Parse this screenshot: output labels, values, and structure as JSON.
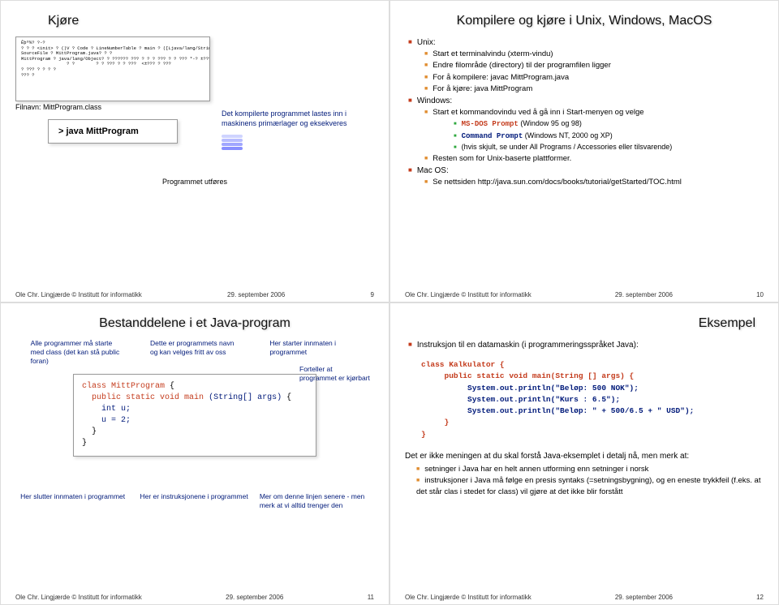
{
  "footer": {
    "author": "Ole Chr. Lingjærde © Institutt for informatikk",
    "date": "29. september 2006"
  },
  "slide9": {
    "num": "9",
    "title": "Kjøre",
    "bytecode": "Êþº¾? ?-?\n? ? ? <init> ? ()V ? Code ? LineNumberTable ? main ? ([Ljava/lang/String;)V ?\nSourceFile ? MittProgram.java? ? ?\nMittProgram ? java/lang/Object? ? ?????? ??? ? ? ? ??? ? ? ??? *-? ±??? ? ??? ? ??? ?\n                 ? ?        ? ? ??? ? ? ???  <±??? ? ???\n? ??? ? ? ? ?\n??? ?",
    "filnavn": "Filnavn: MittProgram.class",
    "prompt": "> java MittProgram",
    "annot1": "Det kompilerte programmet lastes inn i maskinens primærlager og eksekveres",
    "annot2": "Programmet utføres"
  },
  "slide10": {
    "num": "10",
    "title": "Kompilere og kjøre i Unix, Windows, MacOS",
    "unix_h": "Unix:",
    "unix1": "Start et terminalvindu (xterm-vindu)",
    "unix2": "Endre filområde (directory) til der programfilen ligger",
    "unix3": "For å kompilere: javac MittProgram.java",
    "unix4": "For å kjøre: java MittProgram",
    "win_h": "Windows:",
    "win1": "Start et kommandovindu ved å gå inn i Start-menyen og velge",
    "win1a": "MS-DOS Prompt",
    "win1a_sfx": " (Window 95 og 98)",
    "win1b": "Command Prompt",
    "win1b_sfx": " (Windows NT, 2000 og XP)",
    "win1c": "(hvis skjult, se under All Programs / Accessories eller tilsvarende)",
    "win2": "Resten som for Unix-baserte plattformer.",
    "mac_h": "Mac OS:",
    "mac1": "Se nettsiden http://java.sun.com/docs/books/tutorial/getStarted/TOC.html"
  },
  "slide11": {
    "num": "11",
    "title": "Bestanddelene i et Java-program",
    "a1": "Alle programmer må starte med class (det kan stå public foran)",
    "a2": "Dette er programmets navn og kan velges fritt av oss",
    "a3": "Her starter innmaten i programmet",
    "a4": "Forteller at programmet er kjørbart",
    "a5": "Her slutter innmaten i programmet",
    "a6": "Her er instruksjonene i programmet",
    "a7": "Mer om denne linjen senere - men merk at vi alltid trenger den",
    "code": "class MittProgram {\n  public static void main (String[] args) {\n    int u;\n    u = 2;\n  }\n}"
  },
  "slide12": {
    "num": "12",
    "title": "Eksempel",
    "intro": "Instruksjon til en datamaskin (i programmeringsspråket Java):",
    "code_l1": "class Kalkulator {",
    "code_l2": "     public static void main(String [] args) {",
    "code_l3": "          System.out.println(\"Beløp: 500 NOK\");",
    "code_l4": "          System.out.println(\"Kurs : 6.5\");",
    "code_l5": "          System.out.println(\"Beløp: \" + 500/6.5 + \" USD\");",
    "code_l6": "     }",
    "code_l7": "}",
    "note_intro": "Det er ikke meningen at du skal forstå Java-eksemplet i detalj nå, men merk at:",
    "note1": "setninger i Java har en helt annen utforming enn setninger i norsk",
    "note2": "instruksjoner i Java må følge en presis syntaks (=setningsbygning), og en eneste trykkfeil (f.eks. at det står clas i stedet for class) vil gjøre at det ikke blir forstått"
  }
}
